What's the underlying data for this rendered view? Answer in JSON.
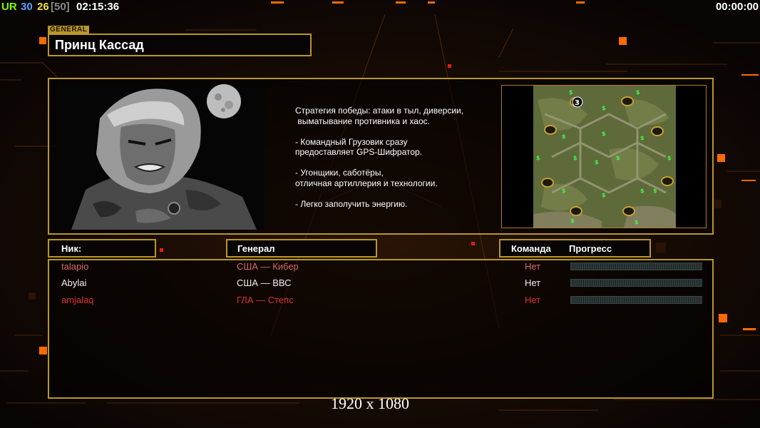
{
  "hud": {
    "tag": "UR",
    "count_a": "30",
    "count_b": "26",
    "count_c": "[50]",
    "clock": "02:15:36",
    "timer": "00:00:00"
  },
  "general": {
    "tag": "GENERAL",
    "name": "Принц Кассад",
    "description": [
      "Стратегия победы: атаки в тыл, диверсии,",
      " выматывание противника и хаос.",
      "",
      "- Командный Грузовик сразу",
      "предоставляет GPS-Шифратор.",
      "",
      "- Угонщики, саботёры,",
      "отличная артиллерия и технологии.",
      "",
      "- Легко заполучить энергию."
    ],
    "map_player_marker": "3"
  },
  "table": {
    "headers": {
      "nick": "Ник:",
      "general": "Генерал",
      "team": "Команда",
      "progress": "Прогресс"
    },
    "rows": [
      {
        "nick": "talapio",
        "general": "США — Кибер",
        "team": "Нет",
        "color": "#d96a6a",
        "progress": 0
      },
      {
        "nick": "Abylai",
        "general": "США — ВВС",
        "team": "Нет",
        "color": "#f0f0f0",
        "progress": 0
      },
      {
        "nick": "amjalaq",
        "general": "ГЛА — Степс",
        "team": "Нет",
        "color": "#e03030",
        "progress": 0
      }
    ]
  },
  "resolution": "1920 x 1080",
  "colors": {
    "frame_gold": "#b8962a",
    "accent_orange": "#ff6a00",
    "hud_green": "#7cfc00",
    "hud_blue": "#5aa0ff",
    "hud_yellow": "#f0e040"
  }
}
